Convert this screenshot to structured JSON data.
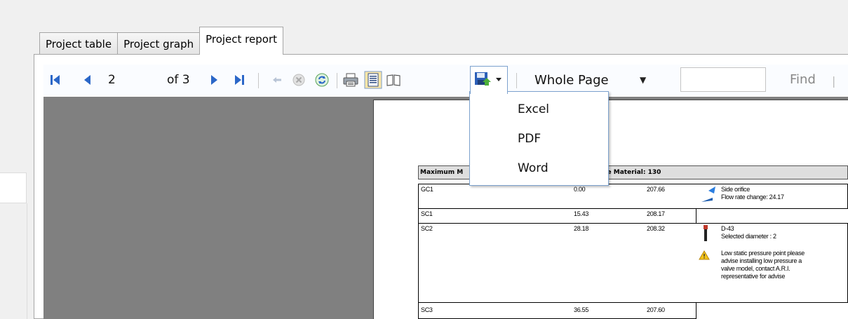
{
  "tabs": [
    "Project table",
    "Project graph",
    "Project report"
  ],
  "active_tab": "Project report",
  "toolbar": {
    "current_page": "2",
    "of_label": "of 3",
    "zoom_value": "Whole Page",
    "find_label": "Find",
    "find_separator": "|"
  },
  "export_menu": {
    "items": [
      "Excel",
      "PDF",
      "Word"
    ]
  },
  "report": {
    "header_left": "Maximum M",
    "header_right": "meter: 200 ,Pipe Material: 130",
    "rows": [
      {
        "name": "GC1",
        "v1": "0.00",
        "v2": "207.66",
        "notes": [
          "Side orifice",
          "Flow rate change: 24.17"
        ]
      },
      {
        "name": "SC1",
        "v1": "15.43",
        "v2": "208.17",
        "notes": []
      },
      {
        "name": "SC2",
        "v1": "28.18",
        "v2": "208.32",
        "notes": [
          "D-43",
          "Selected diameter : 2",
          "Low static pressure point please",
          "advise installing low pressure a",
          "valve model, contact A.R.I.",
          "representative for advise"
        ]
      },
      {
        "name": "SC3",
        "v1": "36.55",
        "v2": "207.60",
        "notes": []
      }
    ]
  },
  "colors": {
    "accent": "#2b67c8",
    "canvas": "#808080",
    "menu_border": "#7da2ce"
  }
}
